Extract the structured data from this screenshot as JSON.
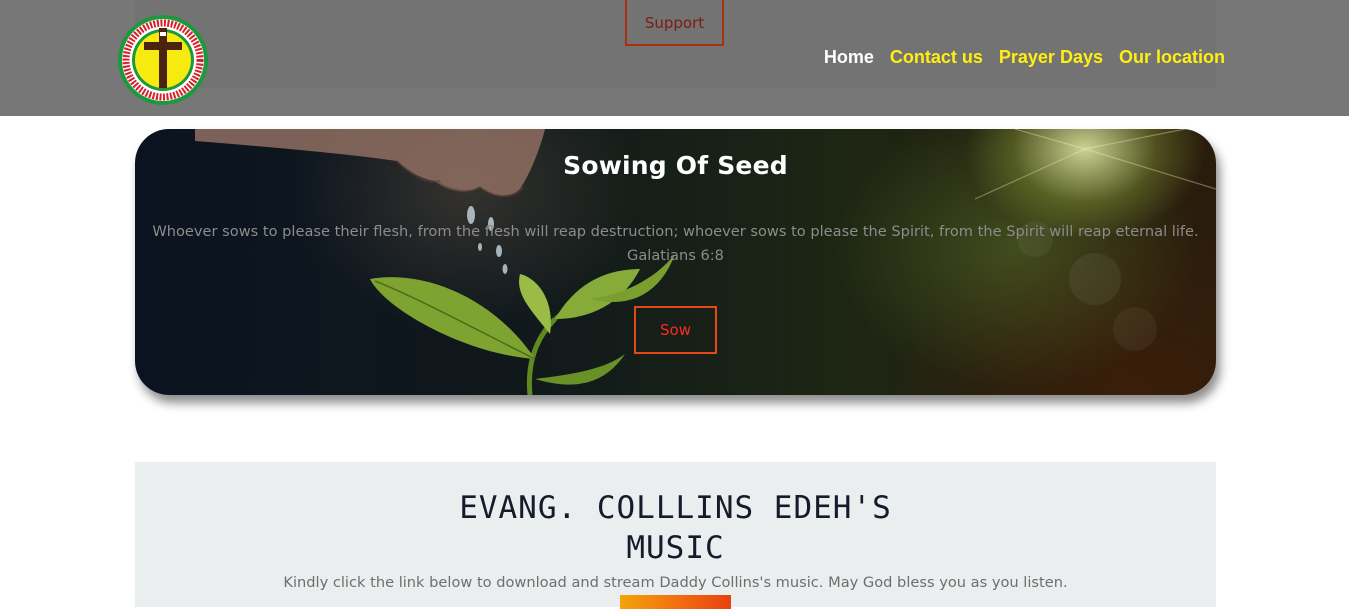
{
  "header": {
    "logo_alt": "Church logo",
    "support_label": "Support",
    "nav": [
      {
        "label": "Home",
        "active": true
      },
      {
        "label": "Contact us",
        "active": false
      },
      {
        "label": "Prayer Days",
        "active": false
      },
      {
        "label": "Our location",
        "active": false
      }
    ]
  },
  "hero": {
    "title": "Sowing Of Seed",
    "quote": "Whoever sows to please their flesh, from the flesh will reap destruction; whoever sows to please the Spirit, from the Spirit will reap eternal life.",
    "reference": "Galatians 6:8",
    "button_label": "Sow"
  },
  "music": {
    "title_line1": "EVANG. COLLLINS EDEH'S",
    "title_line2": "MUSIC",
    "subtitle": "Kindly click the link below to download and stream Daddy Collins's music. May God bless you as you listen."
  },
  "colors": {
    "header_bg": "#777777",
    "nav_active": "#ffffff",
    "nav_link": "#ffef11",
    "accent_button": "#e6461a",
    "music_bg": "#ebeeef"
  }
}
